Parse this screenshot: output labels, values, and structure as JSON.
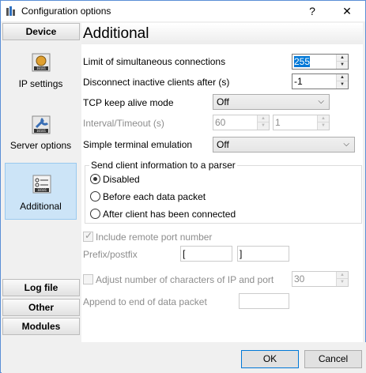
{
  "window": {
    "title": "Configuration options",
    "help_label": "?",
    "close_label": "✕"
  },
  "nav": {
    "header": "Device",
    "items": [
      {
        "label": "IP settings",
        "icon": "network-settings-icon"
      },
      {
        "label": "Server options",
        "icon": "wrench-icon"
      },
      {
        "label": "Additional",
        "icon": "list-options-icon",
        "selected": true
      }
    ],
    "bottom": [
      {
        "label": "Log file"
      },
      {
        "label": "Other"
      },
      {
        "label": "Modules"
      }
    ]
  },
  "section": {
    "title": "Additional"
  },
  "form": {
    "limit_label": "Limit of simultaneous connections",
    "limit_value": "255",
    "disconnect_label": "Disconnect inactive clients after (s)",
    "disconnect_value": "-1",
    "tcp_label": "TCP keep alive mode",
    "tcp_value": "Off",
    "interval_label": "Interval/Timeout (s)",
    "interval_value": "60",
    "timeout_value": "1",
    "terminal_label": "Simple terminal emulation",
    "terminal_value": "Off"
  },
  "parser_group": {
    "title": "Send client information to a parser",
    "options": [
      {
        "label": "Disabled",
        "checked": true
      },
      {
        "label": "Before each data packet",
        "checked": false
      },
      {
        "label": "After client has been connected",
        "checked": false
      }
    ]
  },
  "extra": {
    "include_port_label": "Include remote port number",
    "include_port_checked": true,
    "prefix_label": "Prefix/postfix",
    "prefix_value": "[",
    "postfix_value": "]",
    "adjust_label": "Adjust number of characters of IP and port",
    "adjust_checked": false,
    "adjust_value": "30",
    "append_label": "Append to end of data packet",
    "append_value": ""
  },
  "footer": {
    "ok_label": "OK",
    "cancel_label": "Cancel"
  },
  "colors": {
    "accent": "#0078d7",
    "selected_bg": "#cce4f7",
    "disabled_text": "#8d8d8d"
  }
}
